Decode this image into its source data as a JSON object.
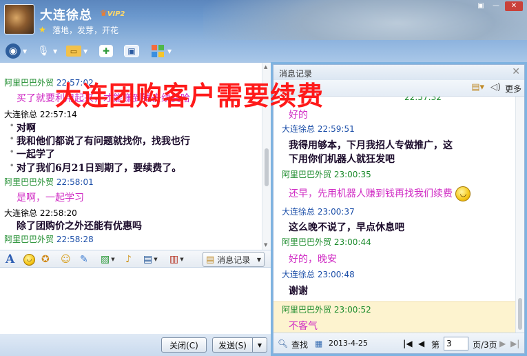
{
  "title": {
    "name": "大连徐总",
    "vip_badge": "VIP2",
    "signature": "落地，发芽，开花"
  },
  "window_controls": [
    "▣",
    "—",
    "✕"
  ],
  "left_chat": {
    "messages": [
      {
        "sender": "阿里巴巴外贸",
        "time": "22:57:02",
        "text": "买了就要利用起来，才能赚到钱去续费哈"
      },
      {
        "sender": "大连徐总",
        "time": "22:57:14",
        "lines": [
          "对啊",
          "我和他们都说了有问题就找你，找我也行",
          "一起学了",
          "对了我们6月21日到期了，要续费了。"
        ]
      },
      {
        "sender": "阿里巴巴外贸",
        "time": "22:58:01",
        "text": "是啊，一起学习"
      },
      {
        "sender": "大连徐总",
        "time": "22:58:20",
        "text": "除了团购价之外还能有优惠吗"
      },
      {
        "sender": "阿里巴巴外贸",
        "time": "22:58:28",
        "text": ""
      }
    ]
  },
  "input_toolbar": {
    "history_button": "消息记录"
  },
  "bottom_buttons": {
    "close": "关闭(C)",
    "send": "发送(S)"
  },
  "history_panel": {
    "title": "消息记录",
    "more": "更多",
    "partial_time": "22:57:32",
    "messages": [
      {
        "sender": "",
        "time": "",
        "text": "好的"
      },
      {
        "sender": "大连徐总",
        "time": "22:59:51",
        "lines": [
          "我得用够本，下月我招人专做推广，这",
          "下用你们机器人就狂发吧"
        ]
      },
      {
        "sender": "阿里巴巴外贸",
        "time": "23:00:35",
        "text": "还早，先用机器人赚到钱再找我们续费"
      },
      {
        "sender": "大连徐总",
        "time": "23:00:37",
        "text": "这么晚不说了，早点休息吧"
      },
      {
        "sender": "阿里巴巴外贸",
        "time": "23:00:44",
        "text": "好的，晚安"
      },
      {
        "sender": "大连徐总",
        "time": "23:00:48",
        "text": "谢谢"
      },
      {
        "sender": "阿里巴巴外贸",
        "time": "23:00:52",
        "text": "不客气"
      }
    ],
    "footer": {
      "find": "查找",
      "date": "2013-4-25",
      "page_label": "第",
      "page_value": "3",
      "page_total": "页/3页"
    }
  },
  "overlay_text": "大连团购客户需要续费",
  "colors": {
    "accent_blue": "#5b86bd",
    "sender_green": "#1a8a2a",
    "sender_blue": "#1b4ea8",
    "message_pink": "#d02cc4",
    "overlay_red": "#ff1a1a",
    "highlight": "#fdf3cf"
  }
}
